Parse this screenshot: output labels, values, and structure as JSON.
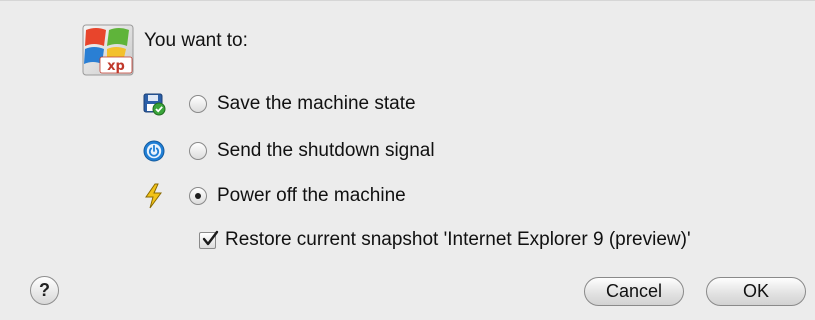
{
  "dialog": {
    "prompt": "You want to:",
    "os_icon_label": "xp",
    "options": [
      {
        "label": "Save the machine state",
        "icon": "floppy-save-icon",
        "selected": false
      },
      {
        "label": "Send the shutdown signal",
        "icon": "power-button-icon",
        "selected": false
      },
      {
        "label": "Power off the machine",
        "icon": "lightning-bolt-icon",
        "selected": true
      }
    ],
    "restore_snapshot": {
      "label": "Restore current snapshot 'Internet Explorer 9 (preview)'",
      "checked": true
    },
    "help_label": "?",
    "cancel_label": "Cancel",
    "ok_label": "OK"
  },
  "colors": {
    "background": "#ececec",
    "power_blue": "#1f7fd6",
    "bolt_yellow": "#f2c318"
  }
}
